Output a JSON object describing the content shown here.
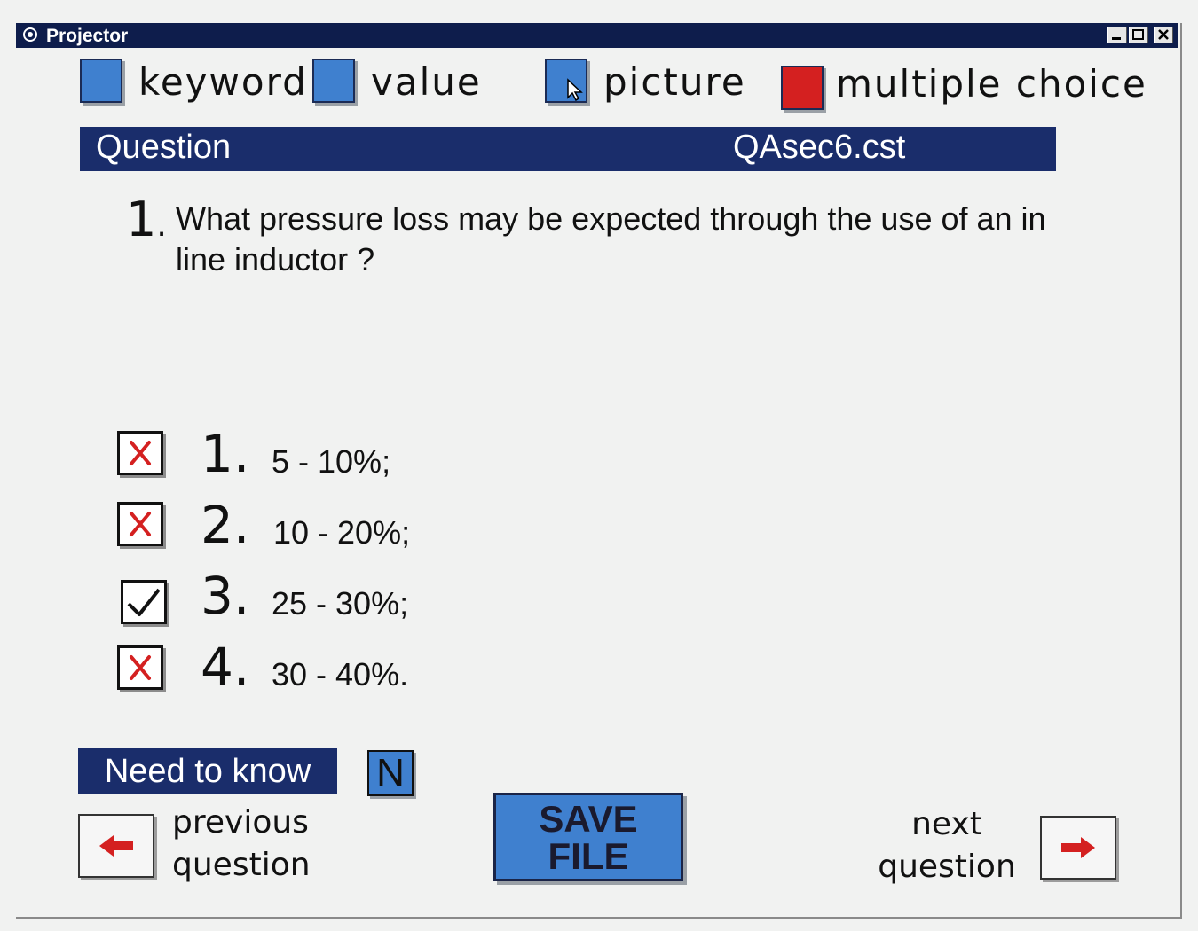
{
  "window": {
    "title": "Projector",
    "icon": "projector-app-icon",
    "controls": [
      "minimize-icon",
      "maximize-icon",
      "close-icon"
    ]
  },
  "modes": [
    {
      "label": "keyword",
      "color": "#3f80cf"
    },
    {
      "label": "value",
      "color": "#3f80cf"
    },
    {
      "label": "picture",
      "color": "#3f80cf"
    },
    {
      "label": "multiple choice",
      "color": "#d42020",
      "selected": true
    }
  ],
  "question_bar": {
    "heading": "Question",
    "file": "QAsec6.cst"
  },
  "question": {
    "number": "1",
    "text": "What pressure loss may be expected through the use of an in line inductor ?"
  },
  "options": [
    {
      "number": "1.",
      "text": "5 - 10%;",
      "mark": "cross"
    },
    {
      "number": "2.",
      "text": "10 - 20%;",
      "mark": "cross"
    },
    {
      "number": "3.",
      "text": "25 - 30%;",
      "mark": "check"
    },
    {
      "number": "4.",
      "text": "30 - 40%.",
      "mark": "cross"
    }
  ],
  "need_to_know": {
    "label": "Need to know",
    "button": "N"
  },
  "navigation": {
    "previous_line1": "previous",
    "previous_line2": "question",
    "next_line1": "next",
    "next_line2": "question",
    "save_line1": "SAVE",
    "save_line2": "FILE"
  },
  "colors": {
    "accent_blue": "#3f80cf",
    "bar_navy": "#1a2d6b",
    "mark_red": "#d42020"
  }
}
